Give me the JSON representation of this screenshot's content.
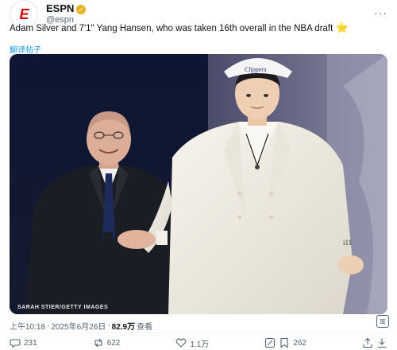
{
  "account": {
    "display_name": "ESPN",
    "handle": "@espn",
    "logo_text": "E"
  },
  "tweet": {
    "text": "Adam Silver and 7'1\" Yang Hansen, who was taken 16th overall in the NBA draft",
    "emoji": "⭐",
    "translate_label": "翻译帖子"
  },
  "photo": {
    "credit": "SARAH STIER/GETTY IMAGES",
    "cap_text": "Clippers",
    "jacket_tag": "i11"
  },
  "meta": {
    "time": "上午10:18",
    "date": "2025年6月26日",
    "views": "82.9万",
    "views_label": "查看",
    "separator": "·"
  },
  "actions": {
    "replies": "231",
    "retweets": "622",
    "likes": "1.1万",
    "bookmarks": "262"
  },
  "colors": {
    "espn_red": "#d50a0a",
    "link_blue": "#1d9bf0",
    "muted": "#536471"
  }
}
